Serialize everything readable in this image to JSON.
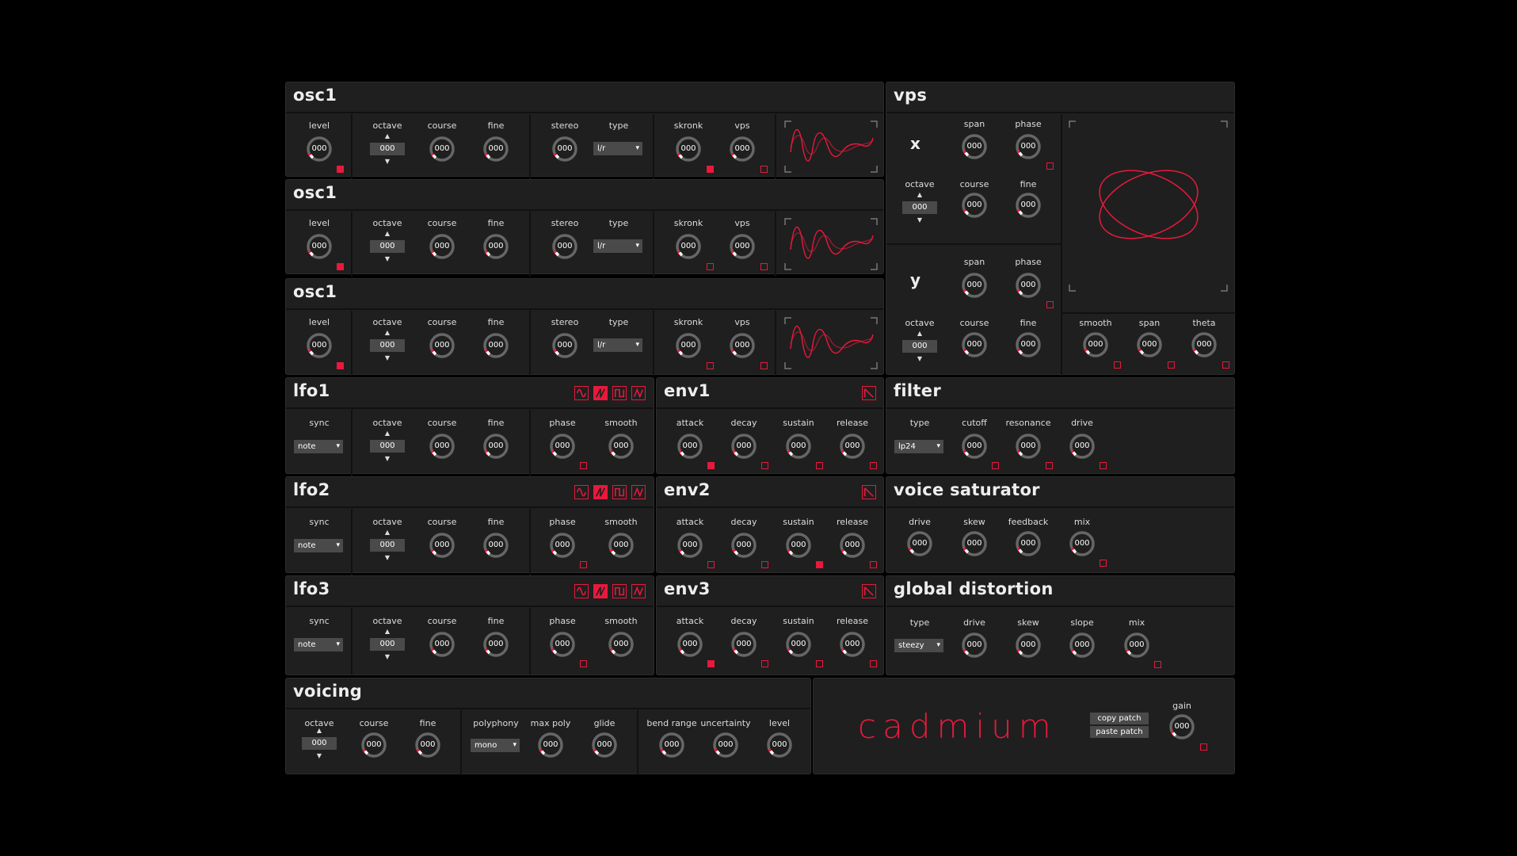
{
  "colors": {
    "accent": "#e8193c",
    "panel": "#1f1f1f",
    "control": "#4a4a4a"
  },
  "osc": [
    {
      "title": "osc1",
      "labels": {
        "level": "level",
        "octave": "octave",
        "course": "course",
        "fine": "fine",
        "stereo": "stereo",
        "type": "type",
        "skronk": "skronk",
        "vps": "vps"
      },
      "values": {
        "level": "000",
        "octave": "000",
        "course": "000",
        "fine": "000",
        "stereo": "000",
        "type": "l/r",
        "skronk": "000",
        "vps": "000"
      },
      "mods": {
        "level": "filled",
        "skronk": "filled",
        "vps": "empty"
      }
    },
    {
      "title": "osc1",
      "labels": {
        "level": "level",
        "octave": "octave",
        "course": "course",
        "fine": "fine",
        "stereo": "stereo",
        "type": "type",
        "skronk": "skronk",
        "vps": "vps"
      },
      "values": {
        "level": "000",
        "octave": "000",
        "course": "000",
        "fine": "000",
        "stereo": "000",
        "type": "l/r",
        "skronk": "000",
        "vps": "000"
      },
      "mods": {
        "level": "filled",
        "skronk": "empty",
        "vps": "empty"
      }
    },
    {
      "title": "osc1",
      "labels": {
        "level": "level",
        "octave": "octave",
        "course": "course",
        "fine": "fine",
        "stereo": "stereo",
        "type": "type",
        "skronk": "skronk",
        "vps": "vps"
      },
      "values": {
        "level": "000",
        "octave": "000",
        "course": "000",
        "fine": "000",
        "stereo": "000",
        "type": "l/r",
        "skronk": "000",
        "vps": "000"
      },
      "mods": {
        "level": "filled",
        "skronk": "empty",
        "vps": "empty"
      }
    }
  ],
  "lfo": [
    {
      "title": "lfo1",
      "labels": {
        "sync": "sync",
        "octave": "octave",
        "course": "course",
        "fine": "fine",
        "phase": "phase",
        "smooth": "smooth"
      },
      "values": {
        "sync": "note",
        "octave": "000",
        "course": "000",
        "fine": "000",
        "phase": "000",
        "smooth": "000"
      },
      "shape_selected": 1,
      "mod": "empty"
    },
    {
      "title": "lfo2",
      "labels": {
        "sync": "sync",
        "octave": "octave",
        "course": "course",
        "fine": "fine",
        "phase": "phase",
        "smooth": "smooth"
      },
      "values": {
        "sync": "note",
        "octave": "000",
        "course": "000",
        "fine": "000",
        "phase": "000",
        "smooth": "000"
      },
      "shape_selected": 1,
      "mod": "empty"
    },
    {
      "title": "lfo3",
      "labels": {
        "sync": "sync",
        "octave": "octave",
        "course": "course",
        "fine": "fine",
        "phase": "phase",
        "smooth": "smooth"
      },
      "values": {
        "sync": "note",
        "octave": "000",
        "course": "000",
        "fine": "000",
        "phase": "000",
        "smooth": "000"
      },
      "shape_selected": 1,
      "mod": "empty"
    }
  ],
  "lfo_shapes": [
    "sine-wave-icon",
    "saw-wave-icon",
    "square-wave-icon",
    "triangle-wave-icon"
  ],
  "env": [
    {
      "title": "env1",
      "labels": {
        "attack": "attack",
        "decay": "decay",
        "sustain": "sustain",
        "release": "release"
      },
      "values": {
        "attack": "000",
        "decay": "000",
        "sustain": "000",
        "release": "000"
      },
      "mods": {
        "attack": "filled",
        "decay": "empty",
        "sustain": "empty",
        "release": "empty"
      }
    },
    {
      "title": "env2",
      "labels": {
        "attack": "attack",
        "decay": "decay",
        "sustain": "sustain",
        "release": "release"
      },
      "values": {
        "attack": "000",
        "decay": "000",
        "sustain": "000",
        "release": "000"
      },
      "mods": {
        "attack": "empty",
        "decay": "empty",
        "sustain": "filled",
        "release": "empty"
      }
    },
    {
      "title": "env3",
      "labels": {
        "attack": "attack",
        "decay": "decay",
        "sustain": "sustain",
        "release": "release"
      },
      "values": {
        "attack": "000",
        "decay": "000",
        "sustain": "000",
        "release": "000"
      },
      "mods": {
        "attack": "filled",
        "decay": "empty",
        "sustain": "empty",
        "release": "empty"
      }
    }
  ],
  "vps": {
    "title": "vps",
    "x_label": "x",
    "y_label": "y",
    "labels": {
      "span": "span",
      "phase": "phase",
      "octave": "octave",
      "course": "course",
      "fine": "fine",
      "smooth": "smooth",
      "theta": "theta"
    },
    "values": {
      "x_span": "000",
      "x_phase": "000",
      "x_octave": "000",
      "x_course": "000",
      "x_fine": "000",
      "y_span": "000",
      "y_phase": "000",
      "y_octave": "000",
      "y_course": "000",
      "y_fine": "000",
      "smooth": "000",
      "span": "000",
      "theta": "000"
    }
  },
  "filter": {
    "title": "filter",
    "labels": {
      "type": "type",
      "cutoff": "cutoff",
      "resonance": "resonance",
      "drive": "drive"
    },
    "values": {
      "type": "lp24",
      "cutoff": "000",
      "resonance": "000",
      "drive": "000"
    }
  },
  "saturator": {
    "title": "voice saturator",
    "labels": {
      "drive": "drive",
      "skew": "skew",
      "feedback": "feedback",
      "mix": "mix"
    },
    "values": {
      "drive": "000",
      "skew": "000",
      "feedback": "000",
      "mix": "000"
    }
  },
  "distortion": {
    "title": "global distortion",
    "labels": {
      "type": "type",
      "drive": "drive",
      "skew": "skew",
      "slope": "slope",
      "mix": "mix"
    },
    "values": {
      "type": "steezy",
      "drive": "000",
      "skew": "000",
      "slope": "000",
      "mix": "000"
    }
  },
  "voicing": {
    "title": "voicing",
    "labels": {
      "octave": "octave",
      "course": "course",
      "fine": "fine",
      "polyphony": "polyphony",
      "max_poly": "max poly",
      "glide": "glide",
      "bend_range": "bend range",
      "uncertainty": "uncertainty",
      "level": "level"
    },
    "values": {
      "octave": "000",
      "course": "000",
      "fine": "000",
      "polyphony": "mono",
      "max_poly": "000",
      "glide": "000",
      "bend_range": "000",
      "uncertainty": "000",
      "level": "000"
    }
  },
  "master": {
    "brand": "cadmium",
    "copy_patch": "copy patch",
    "paste_patch": "paste patch",
    "gain_label": "gain",
    "gain": "000"
  }
}
